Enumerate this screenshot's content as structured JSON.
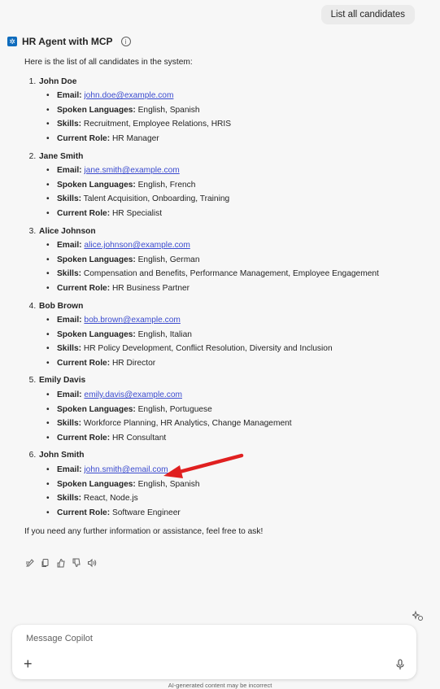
{
  "user_message": "List all candidates",
  "agent": {
    "name": "HR Agent with MCP",
    "info_icon": "info-icon"
  },
  "response": {
    "intro": "Here is the list of all candidates in the system:",
    "labels": {
      "email": "Email:",
      "languages": "Spoken Languages:",
      "skills": "Skills:",
      "role": "Current Role:"
    },
    "candidates": [
      {
        "name": "John Doe",
        "email": "john.doe@example.com",
        "languages": "English, Spanish",
        "skills": "Recruitment, Employee Relations, HRIS",
        "role": "HR Manager"
      },
      {
        "name": "Jane Smith",
        "email": "jane.smith@example.com",
        "languages": "English, French",
        "skills": "Talent Acquisition, Onboarding, Training",
        "role": "HR Specialist"
      },
      {
        "name": "Alice Johnson",
        "email": "alice.johnson@example.com",
        "languages": "English, German",
        "skills": "Compensation and Benefits, Performance Management, Employee Engagement",
        "role": "HR Business Partner"
      },
      {
        "name": "Bob Brown",
        "email": "bob.brown@example.com",
        "languages": "English, Italian",
        "skills": "HR Policy Development, Conflict Resolution, Diversity and Inclusion",
        "role": "HR Director"
      },
      {
        "name": "Emily Davis",
        "email": "emily.davis@example.com",
        "languages": "English, Portuguese",
        "skills": "Workforce Planning, HR Analytics, Change Management",
        "role": "HR Consultant"
      },
      {
        "name": "John Smith",
        "email": "john.smith@email.com",
        "languages": "English, Spanish",
        "skills": "React, Node.js",
        "role": "Software Engineer"
      }
    ],
    "outro": "If you need any further information or assistance, feel free to ask!"
  },
  "action_icons": [
    "edit-icon",
    "copy-icon",
    "thumbs-up-icon",
    "thumbs-down-icon",
    "read-aloud-icon"
  ],
  "annotation": {
    "color": "#e02020",
    "points_to": "john.smith@email.com"
  },
  "composer": {
    "placeholder": "Message Copilot",
    "value": ""
  },
  "disclaimer": "AI-generated content may be incorrect",
  "colors": {
    "accent": "#0f6cbd",
    "link": "#3b4bcf",
    "background": "#f7f7f7"
  }
}
